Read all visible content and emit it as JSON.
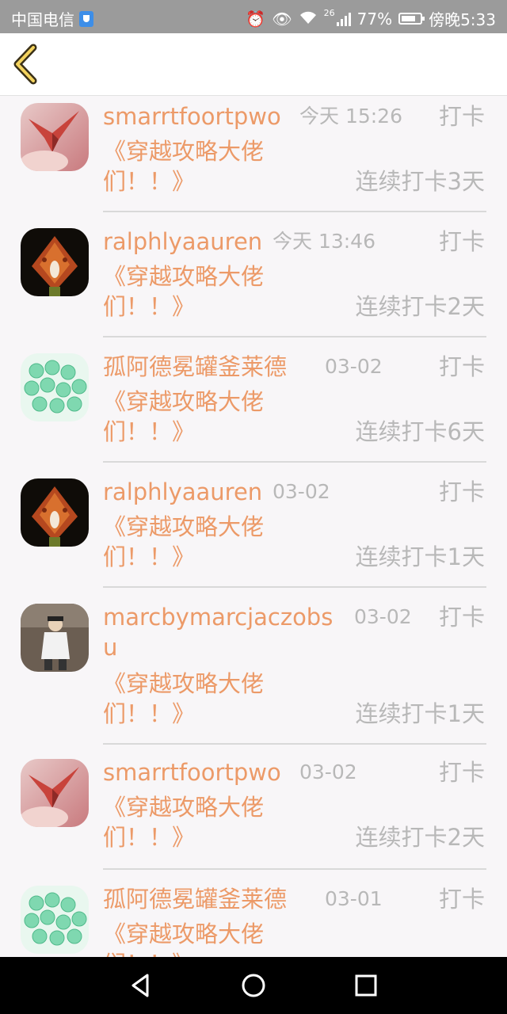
{
  "status": {
    "carrier": "中国电信",
    "network": "26",
    "battery": "77%",
    "battery_fraction": 0.77,
    "time": "傍晚5:33"
  },
  "icons": {
    "back": "chevron-left-icon",
    "accent": "#ec9a68"
  },
  "entries": [
    {
      "name": "smarrtfoortpwo",
      "time": "今天 15:26",
      "action": "打卡",
      "title": "《穿越攻略大佬们！！》",
      "streak": "连续打卡3天",
      "avatar": "crane"
    },
    {
      "name": "ralphlyaauren",
      "time": "今天 13:46",
      "action": "打卡",
      "title": "《穿越攻略大佬们！！》",
      "streak": "连续打卡2天",
      "avatar": "orchid"
    },
    {
      "name": "孤阿德冕罐釜莱德",
      "time": "03-02",
      "action": "打卡",
      "title": "《穿越攻略大佬们！！》",
      "streak": "连续打卡6天",
      "avatar": "beads"
    },
    {
      "name": "ralphlyaauren",
      "time": "03-02",
      "action": "打卡",
      "title": "《穿越攻略大佬们！！》",
      "streak": "连续打卡1天",
      "avatar": "orchid"
    },
    {
      "name": "marcbymarcjaczobsu",
      "time": "03-02",
      "action": "打卡",
      "title": "《穿越攻略大佬们！！》",
      "streak": "连续打卡1天",
      "avatar": "person"
    },
    {
      "name": "smarrtfoortpwo",
      "time": "03-02",
      "action": "打卡",
      "title": "《穿越攻略大佬们！！》",
      "streak": "连续打卡2天",
      "avatar": "crane"
    },
    {
      "name": "孤阿德冕罐釜莱德",
      "time": "03-01",
      "action": "打卡",
      "title": "《穿越攻略大佬们！！》",
      "streak": "",
      "avatar": "beads"
    }
  ],
  "navbar": {
    "back": "triangle-back-icon",
    "home": "circle-home-icon",
    "recents": "square-recents-icon"
  }
}
